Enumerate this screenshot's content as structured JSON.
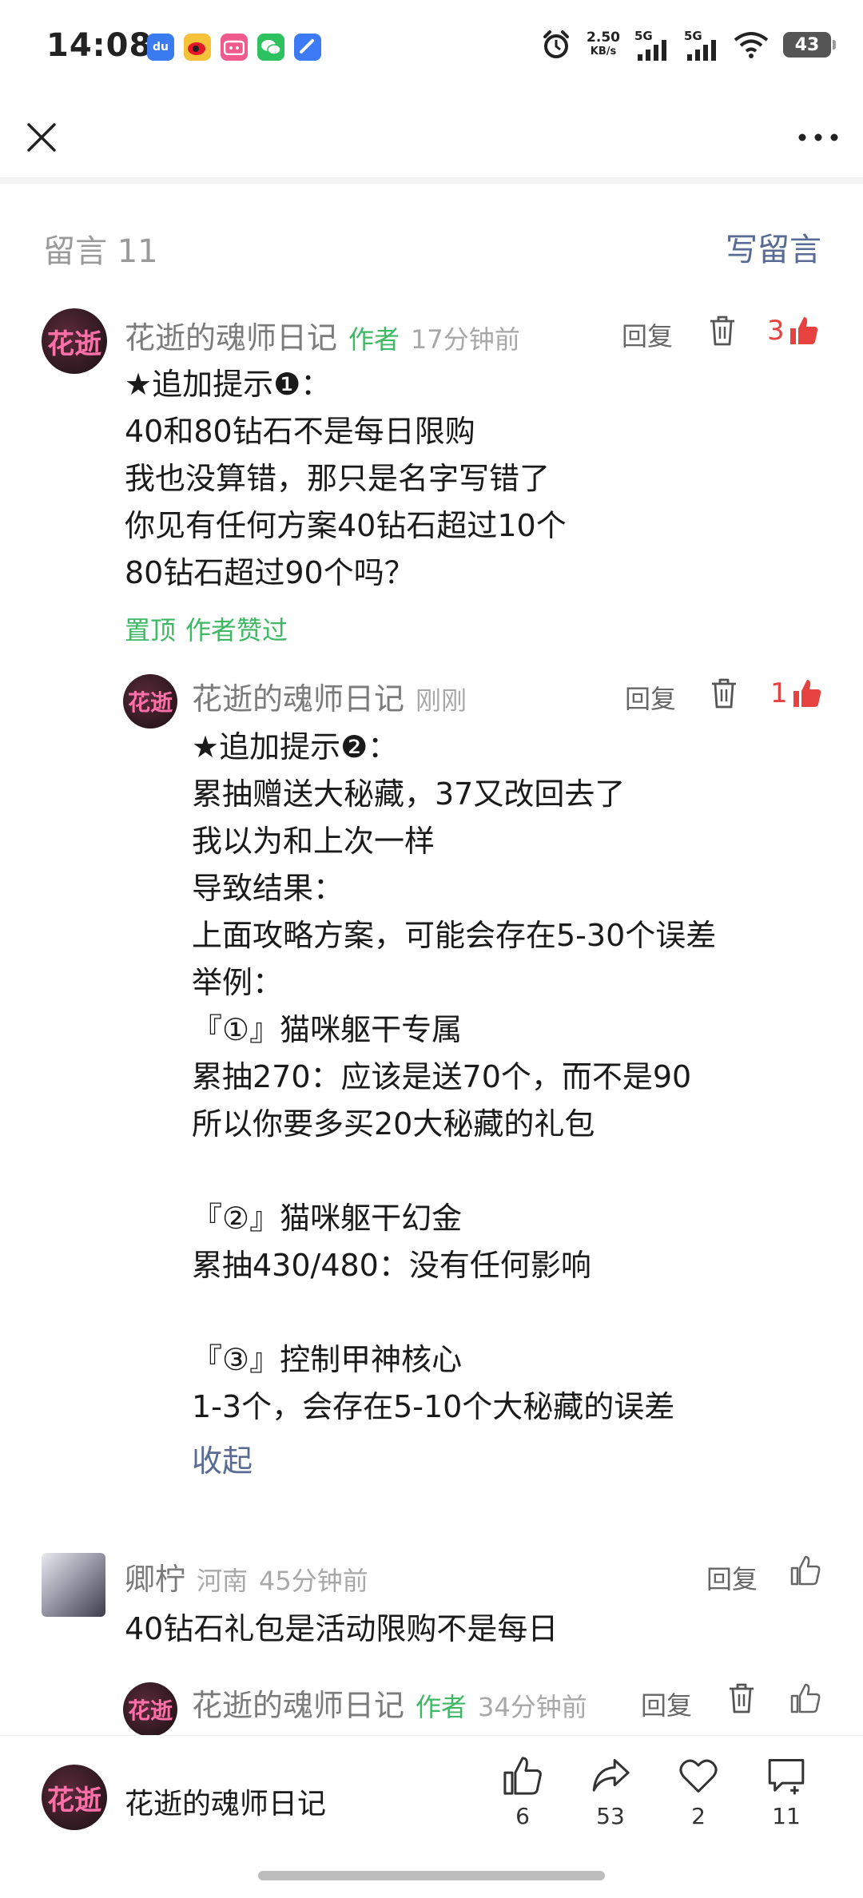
{
  "status": {
    "time": "14:08",
    "net_speed_value": "2.50",
    "net_speed_unit": "KB/s",
    "sig1": "5G",
    "sig2": "5G",
    "battery": "43"
  },
  "comments_section": {
    "count_label": "留言 11",
    "write_label": "写留言"
  },
  "comment1": {
    "nick": "花逝的魂师日记",
    "author_tag": "作者",
    "time": "17分钟前",
    "reply": "回复",
    "likes": "3",
    "text": "★追加提示❶：\n40和80钻石不是每日限购\n我也没算错，那只是名字写错了\n你见有任何方案40钻石超过10个\n80钻石超过90个吗？",
    "pinned": "置顶",
    "author_liked": "作者赞过"
  },
  "reply1": {
    "nick": "花逝的魂师日记",
    "time": "刚刚",
    "reply": "回复",
    "likes": "1",
    "text": "★追加提示❷：\n累抽赠送大秘藏，37又改回去了\n我以为和上次一样\n导致结果：\n上面攻略方案，可能会存在5-30个误差\n举例：\n『①』猫咪躯干专属\n累抽270：应该是送70个，而不是90\n所以你要多买20大秘藏的礼包\n\n『②』猫咪躯干幻金\n累抽430/480：没有任何影响\n\n『③』控制甲神核心\n1-3个，会存在5-10个大秘藏的误差",
    "collapse": "收起"
  },
  "comment2": {
    "nick": "卿柠",
    "location": "河南",
    "time": "45分钟前",
    "reply": "回复",
    "text": "40钻石礼包是活动限购不是每日"
  },
  "reply2": {
    "nick": "花逝的魂师日记",
    "author_tag": "作者",
    "time": "34分钟前",
    "reply": "回复"
  },
  "bottom": {
    "account": "花逝的魂师日记",
    "likes": "6",
    "shares": "53",
    "favorites": "2",
    "comments": "11"
  },
  "colors": {
    "accent_blue": "#576b95",
    "author_green": "#3fb865",
    "like_red": "#e64340"
  }
}
